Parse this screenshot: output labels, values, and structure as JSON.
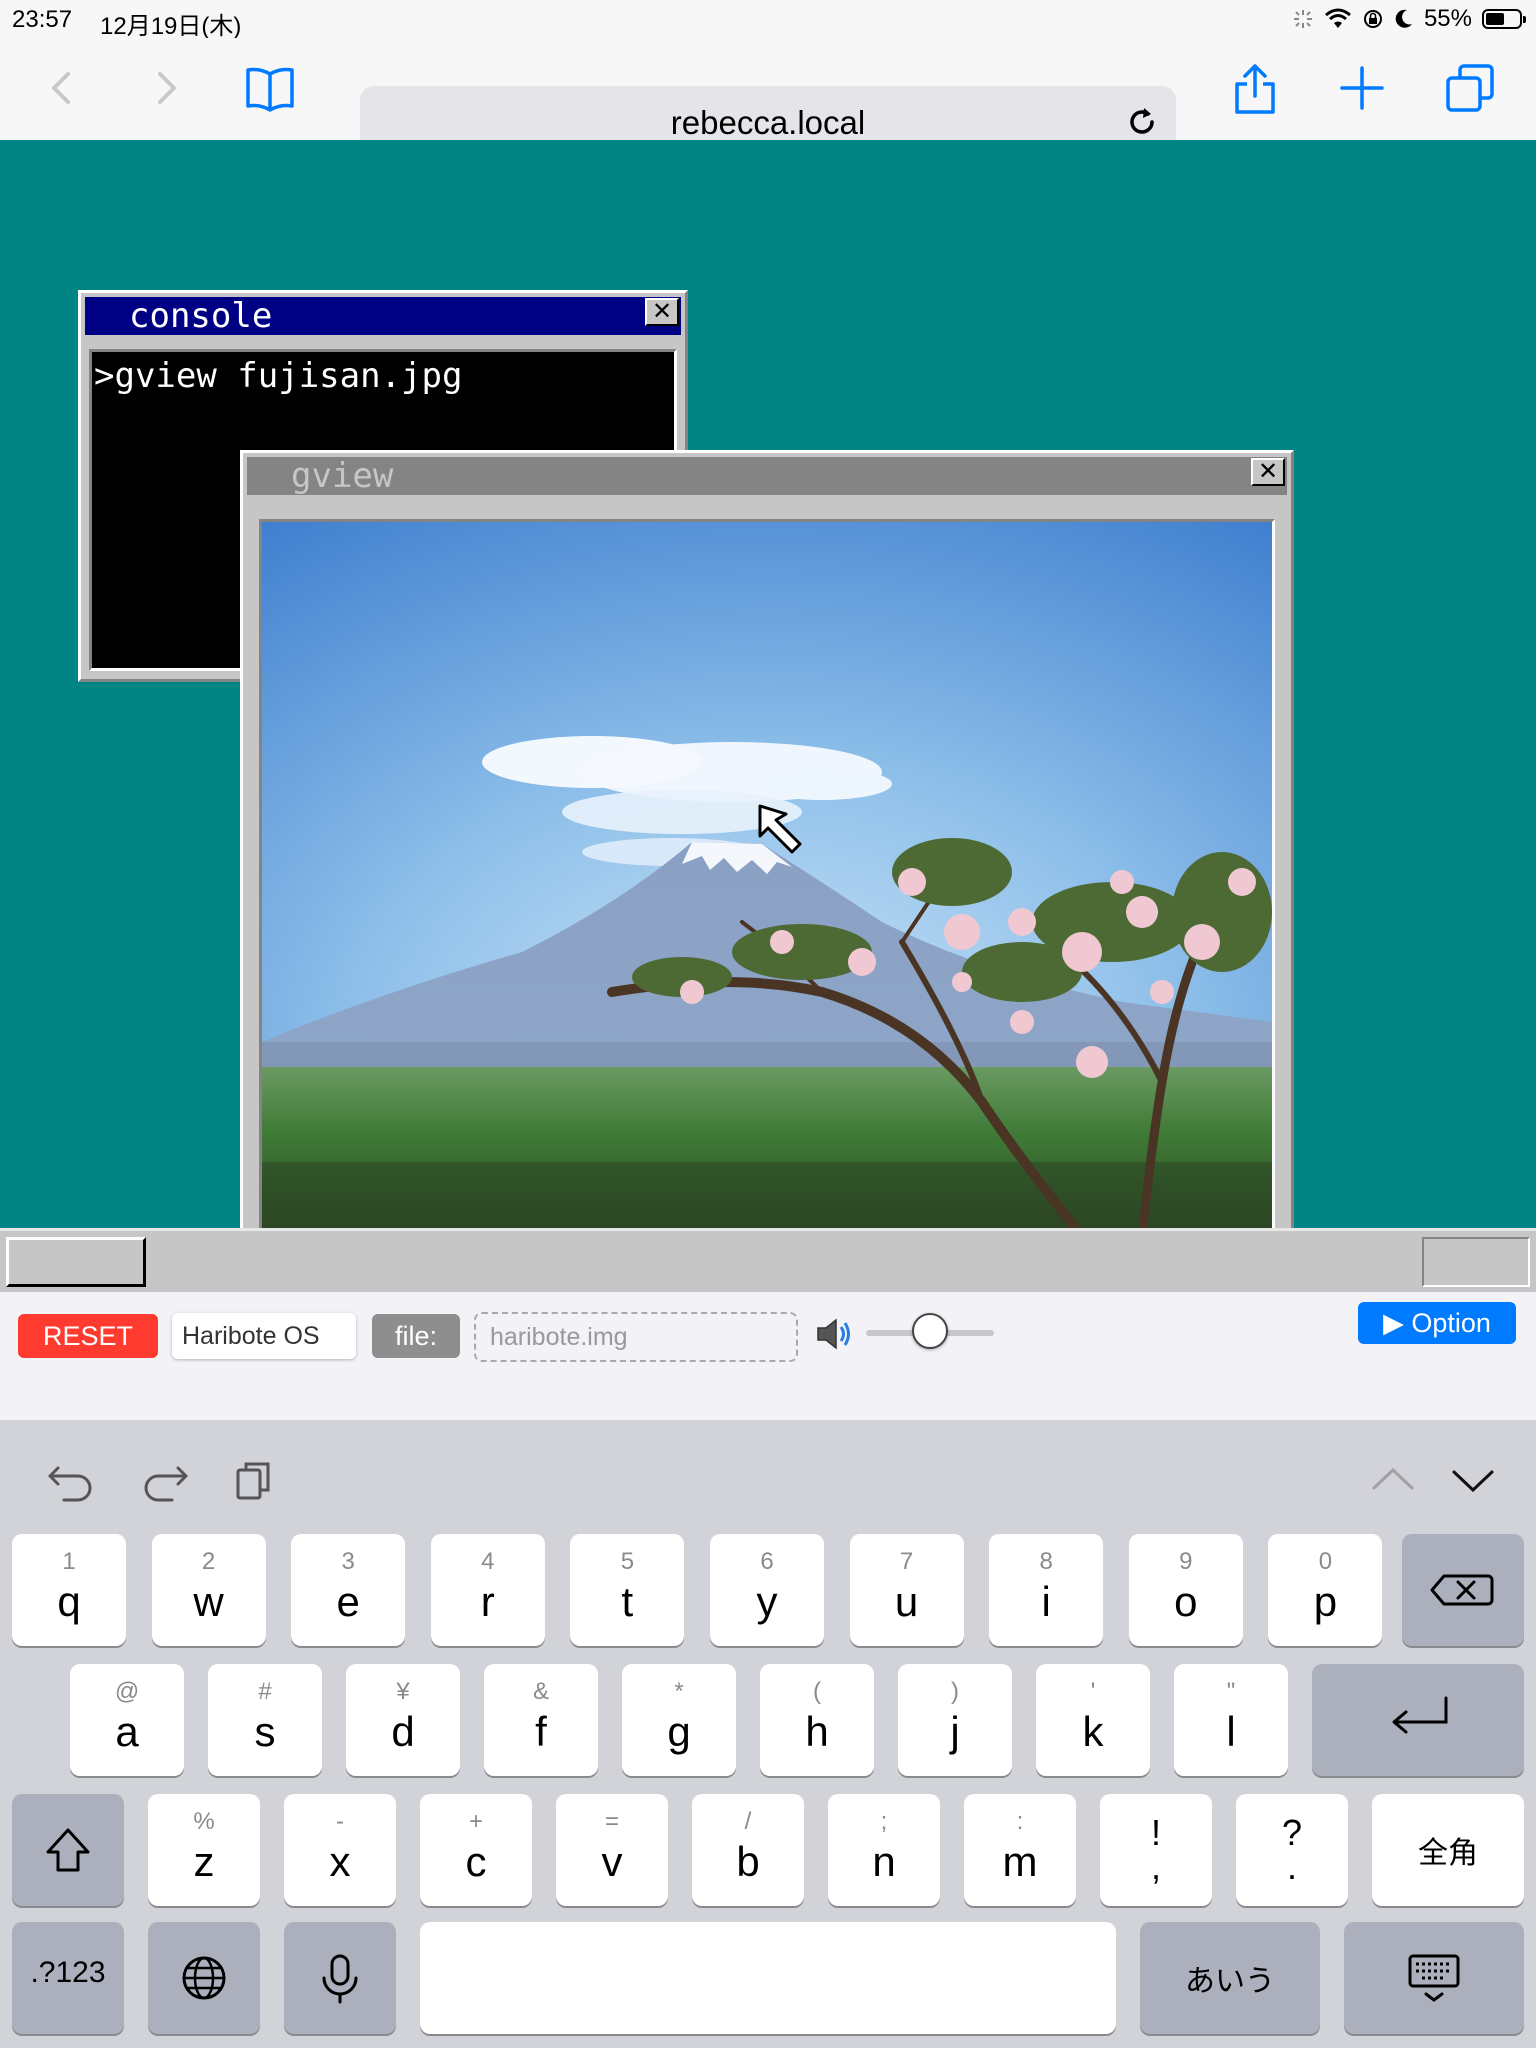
{
  "status_bar": {
    "time": "23:57",
    "date": "12月19日(木)",
    "battery": "55%",
    "battery_level": 0.55
  },
  "browser": {
    "url": "rebecca.local"
  },
  "desktop": {
    "console_window": {
      "title": "console",
      "close": "✕",
      "command": ">gview fujisan.jpg"
    },
    "gview_window": {
      "title": "gview",
      "close": "✕"
    }
  },
  "controls": {
    "reset_label": "RESET",
    "os_name": "Haribote OS",
    "file_label": "file:",
    "file_name": "haribote.img",
    "volume_level": 0.5,
    "option_label": "▶ Option"
  },
  "keyboard": {
    "row1": [
      {
        "hint": "1",
        "label": "q"
      },
      {
        "hint": "2",
        "label": "w"
      },
      {
        "hint": "3",
        "label": "e"
      },
      {
        "hint": "4",
        "label": "r"
      },
      {
        "hint": "5",
        "label": "t"
      },
      {
        "hint": "6",
        "label": "y"
      },
      {
        "hint": "7",
        "label": "u"
      },
      {
        "hint": "8",
        "label": "i"
      },
      {
        "hint": "9",
        "label": "o"
      },
      {
        "hint": "0",
        "label": "p"
      }
    ],
    "row2": [
      {
        "hint": "@",
        "label": "a"
      },
      {
        "hint": "#",
        "label": "s"
      },
      {
        "hint": "¥",
        "label": "d"
      },
      {
        "hint": "&",
        "label": "f"
      },
      {
        "hint": "*",
        "label": "g"
      },
      {
        "hint": "(",
        "label": "h"
      },
      {
        "hint": ")",
        "label": "j"
      },
      {
        "hint": "'",
        "label": "k"
      },
      {
        "hint": "\"",
        "label": "l"
      }
    ],
    "row3": [
      {
        "hint": "%",
        "label": "z"
      },
      {
        "hint": "-",
        "label": "x"
      },
      {
        "hint": "+",
        "label": "c"
      },
      {
        "hint": "=",
        "label": "v"
      },
      {
        "hint": "/",
        "label": "b"
      },
      {
        "hint": ";",
        "label": "n"
      },
      {
        "hint": ":",
        "label": "m"
      }
    ],
    "punct1": {
      "top": "!",
      "bottom": ","
    },
    "punct2": {
      "top": "?",
      "bottom": "."
    },
    "zenkaku": "全角",
    "numbers": ".?123",
    "kana": "あいう"
  }
}
